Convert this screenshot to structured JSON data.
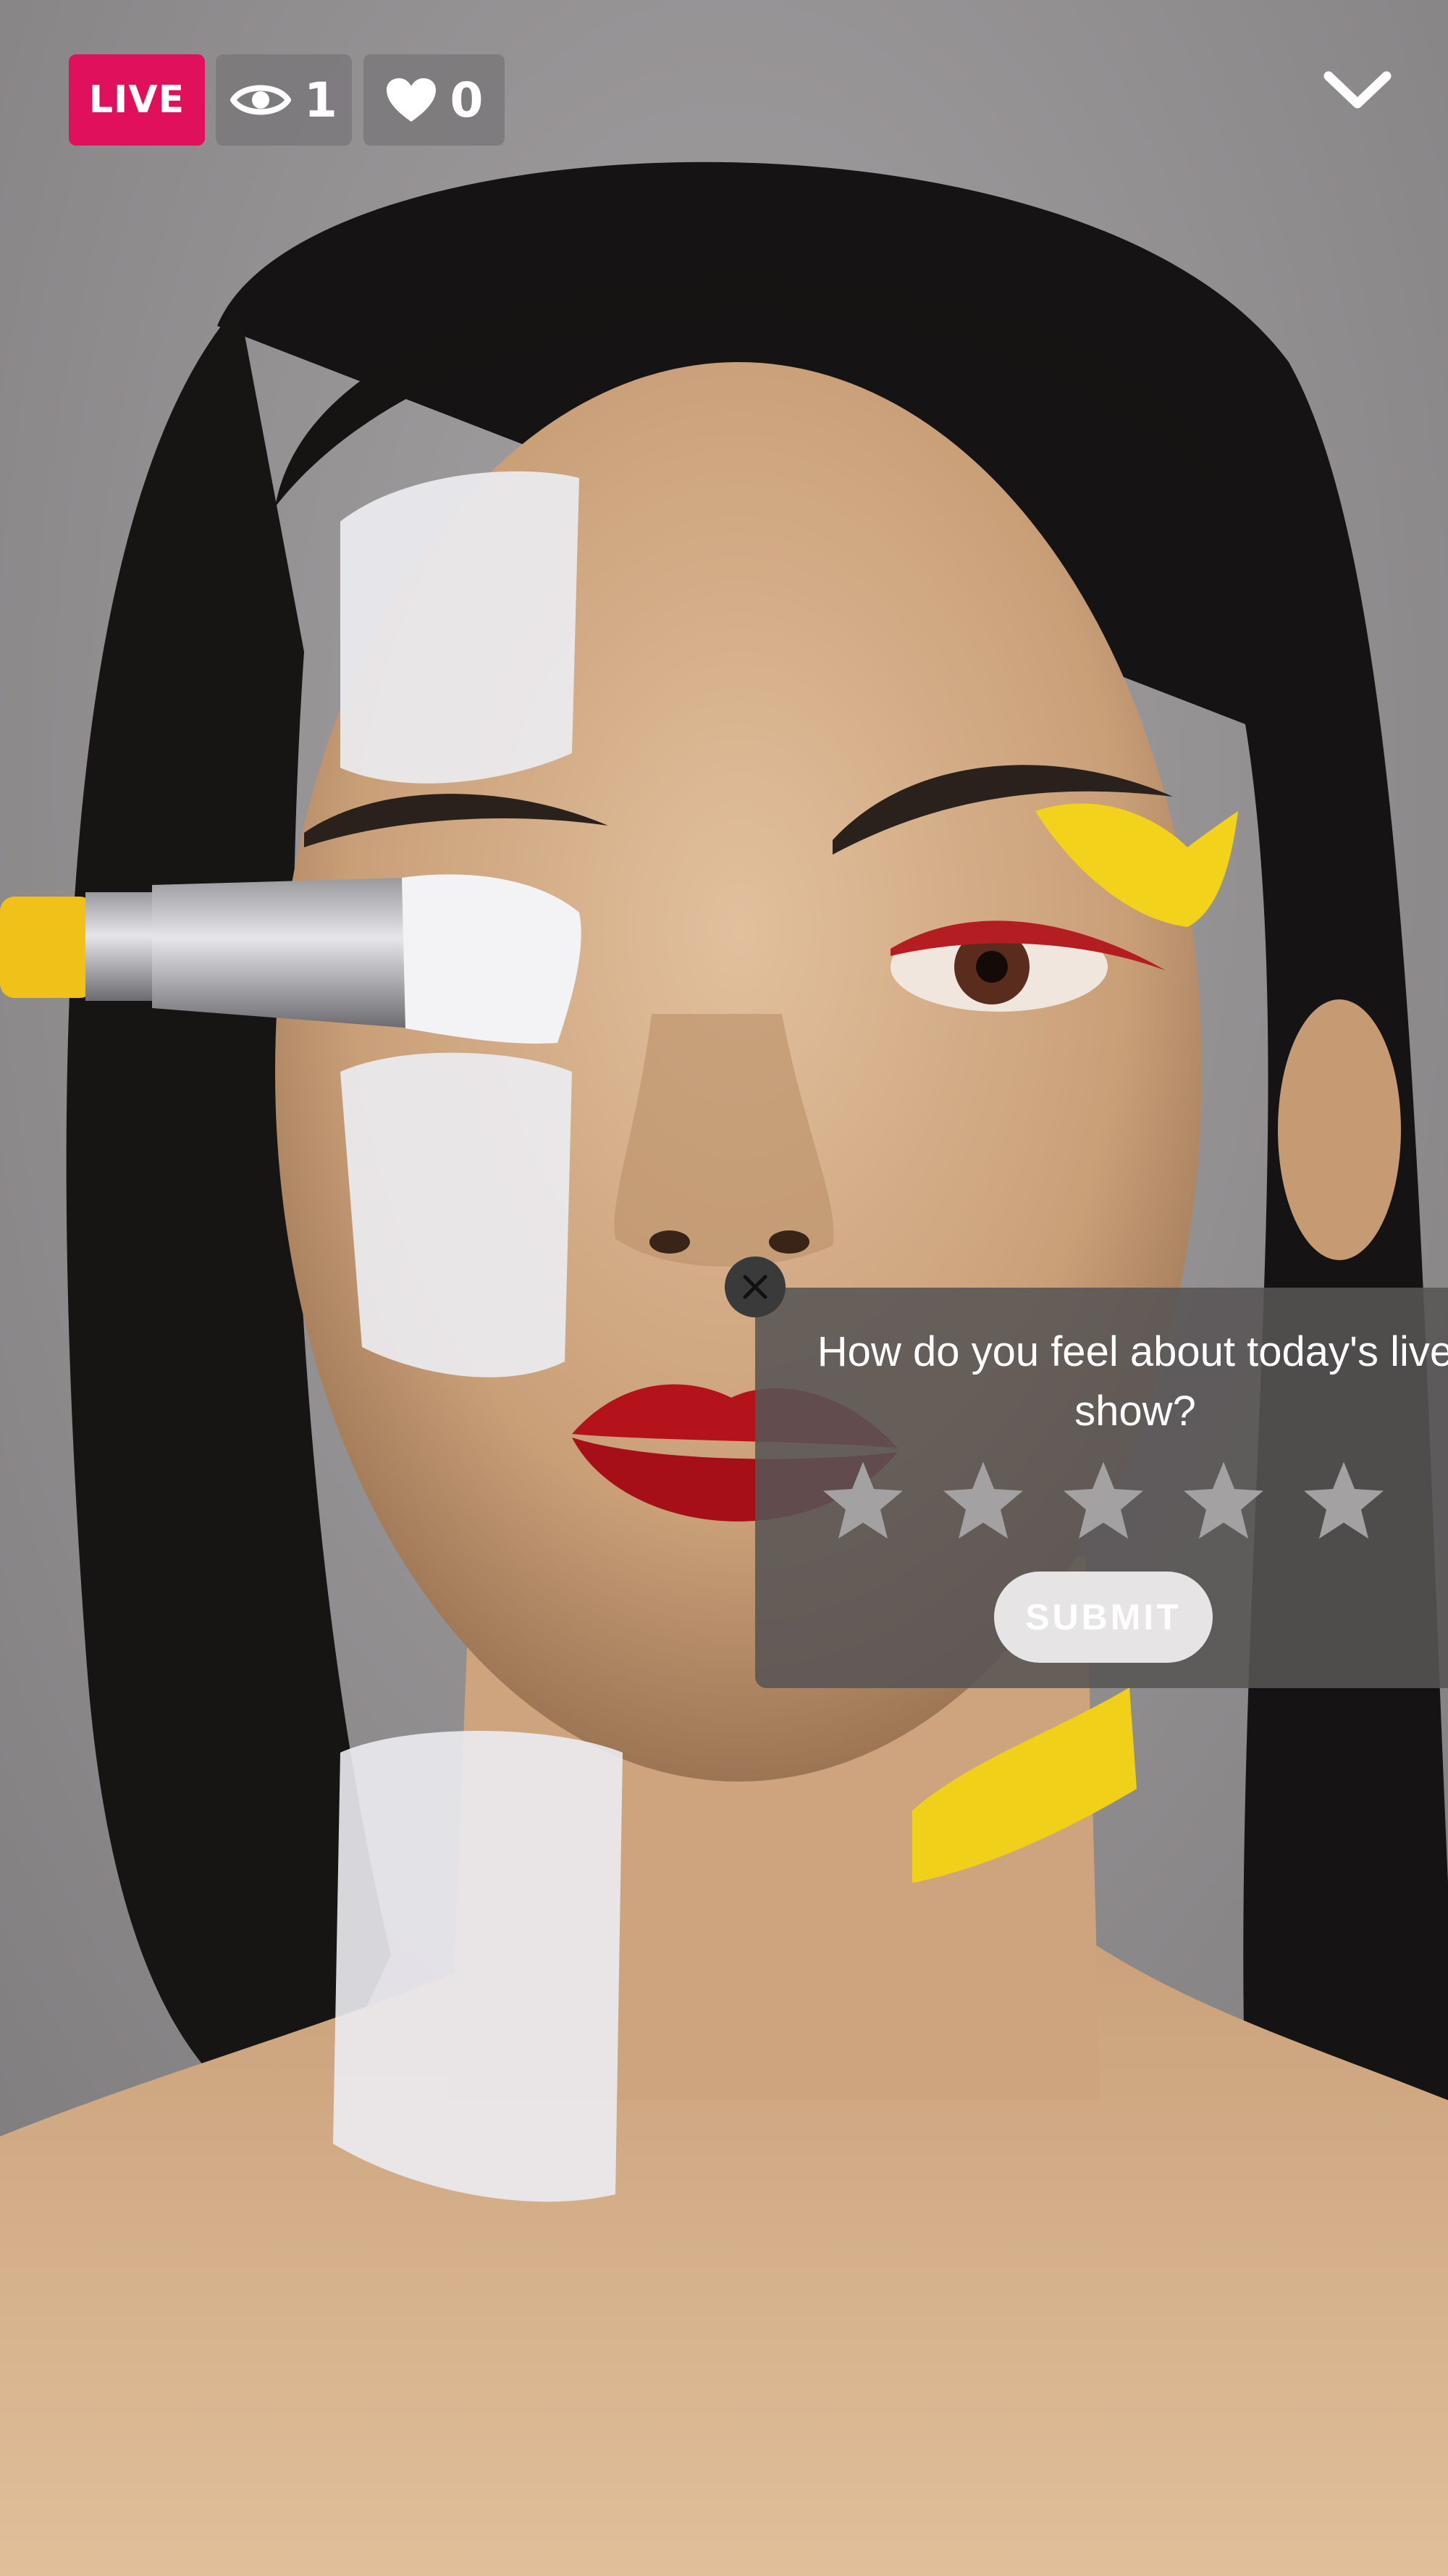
{
  "stream": {
    "live_label": "LIVE",
    "viewers": "1",
    "likes": "0",
    "icons": {
      "viewers": "eye-icon",
      "likes": "heart-icon",
      "collapse": "chevron-down-icon"
    }
  },
  "rating_prompt": {
    "question": "How do you feel about today's live show?",
    "stars": 5,
    "rating": 0,
    "submit_label": "SUBMIT",
    "close_icon": "close-icon"
  },
  "colors": {
    "live_badge": "#e0105c",
    "counter_badge": "#787678",
    "card_background": "#585454",
    "star_empty": "#a3a1a2",
    "submit_background": "#e6e4e4"
  }
}
